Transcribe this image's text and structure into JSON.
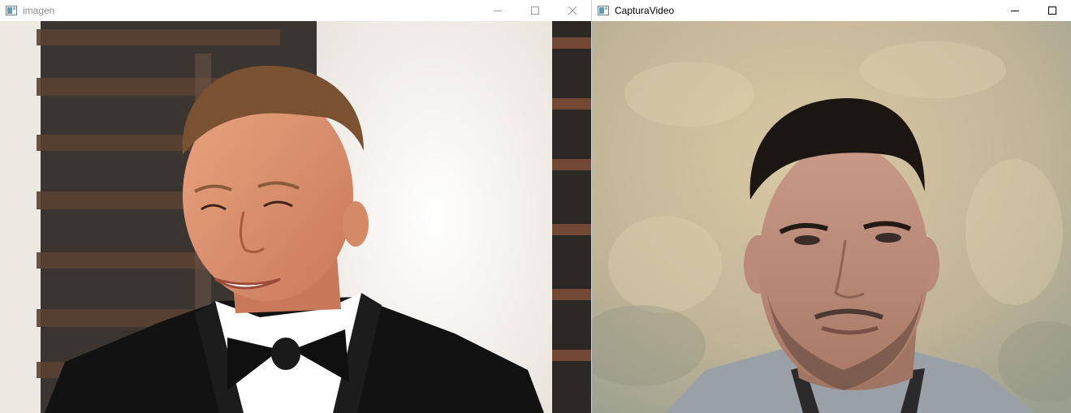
{
  "windows": [
    {
      "title": "imagen",
      "icon": "window-app-icon",
      "controls": [
        "minimize-icon",
        "maximize-icon",
        "close-icon"
      ],
      "content": "image"
    },
    {
      "title": "CapturaVideo",
      "icon": "window-app-icon",
      "controls": [
        "minimize-icon",
        "maximize-icon"
      ],
      "content": "webcam-frame"
    }
  ],
  "colors": {
    "titlebar_bg": "#ffffff",
    "inactive_title_text": "#8c8c8c",
    "active_title_text": "#000000",
    "photo_backdrop_left": "#3b3631",
    "photo_backdrop_white": "#f4f1ec",
    "webcam_wall": "#c4b596"
  }
}
